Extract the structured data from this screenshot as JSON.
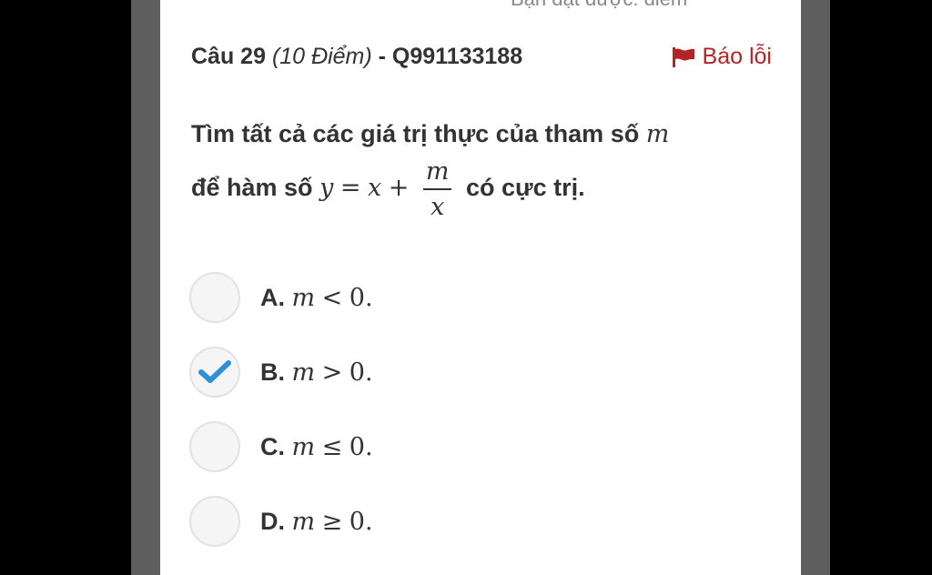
{
  "header": {
    "score_text": "Bạn đạt được: điểm",
    "question_number": "Câu 29",
    "points_text": "(10 Điểm)",
    "question_code": "- Q991133188",
    "report_label": "Báo lỗi"
  },
  "question": {
    "line1_text": "Tìm tất cả các giá trị thực của tham số",
    "line1_var": "m",
    "line2_prefix": "để hàm số",
    "func_y": "y",
    "func_eq": "=",
    "func_x": "x",
    "func_plus": "+",
    "frac_num": "m",
    "frac_den": "x",
    "line2_suffix": "có cực trị."
  },
  "options": [
    {
      "letter": "A.",
      "var": "m",
      "op": "<",
      "val": "0.",
      "selected": false
    },
    {
      "letter": "B.",
      "var": "m",
      "op": ">",
      "val": "0.",
      "selected": true
    },
    {
      "letter": "C.",
      "var": "m",
      "op": "≤",
      "val": "0.",
      "selected": false
    },
    {
      "letter": "D.",
      "var": "m",
      "op": "≥",
      "val": "0.",
      "selected": false
    }
  ],
  "colors": {
    "accent_check": "#2f8fd8",
    "report_red": "#b52424",
    "side_bar": "#5e5e5e"
  },
  "icons": {
    "report": "flag-icon",
    "selected": "checkmark-icon"
  }
}
